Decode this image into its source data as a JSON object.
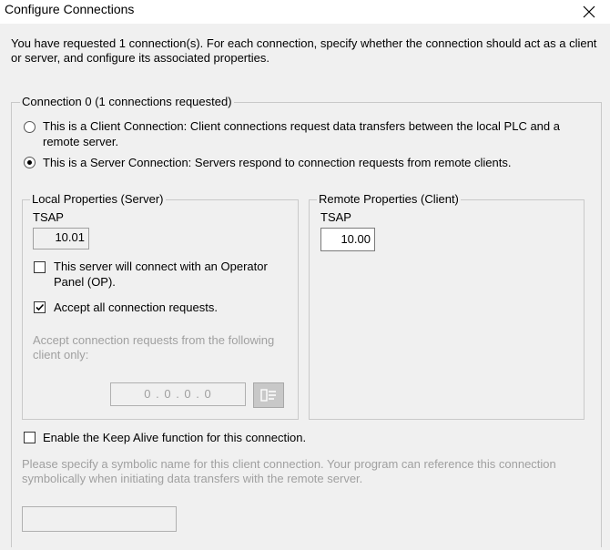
{
  "window": {
    "title": "Configure Connections",
    "close_icon": "close-icon"
  },
  "intro": "You have requested 1 connection(s).  For each connection, specify whether the connection should act as a client or server, and configure its associated properties.",
  "connection": {
    "group_label": "Connection 0 (1 connections requested)",
    "client_option": {
      "line1": "This is a Client Connection: Client connections request data transfers between the local PLC and a",
      "line2": "remote server.",
      "selected": false
    },
    "server_option": {
      "label": "This is a Server Connection: Servers respond to connection requests from remote clients.",
      "selected": true
    }
  },
  "local": {
    "group_label": "Local Properties (Server)",
    "tsap_label": "TSAP",
    "tsap_value": "10.01",
    "op_panel_line1": "This server will connect with an Operator",
    "op_panel_line2": "Panel (OP).",
    "op_panel_checked": false,
    "accept_all_label": "Accept all connection requests.",
    "accept_all_checked": true,
    "accept_from_line1": "Accept connection requests from the following",
    "accept_from_line2": "client only:",
    "ip_value": "0 . 0 . 0 . 0",
    "ip_button_icon": "network-address-icon"
  },
  "remote": {
    "group_label": "Remote Properties (Client)",
    "tsap_label": "TSAP",
    "tsap_value": "10.00"
  },
  "keep_alive": {
    "label": "Enable the Keep Alive function for this connection.",
    "checked": false
  },
  "symbolic": {
    "line1": "Please specify a symbolic name for this client connection.  Your program can reference this connection",
    "line2": "symbolically when initiating data transfers with the remote server.",
    "value": ""
  }
}
